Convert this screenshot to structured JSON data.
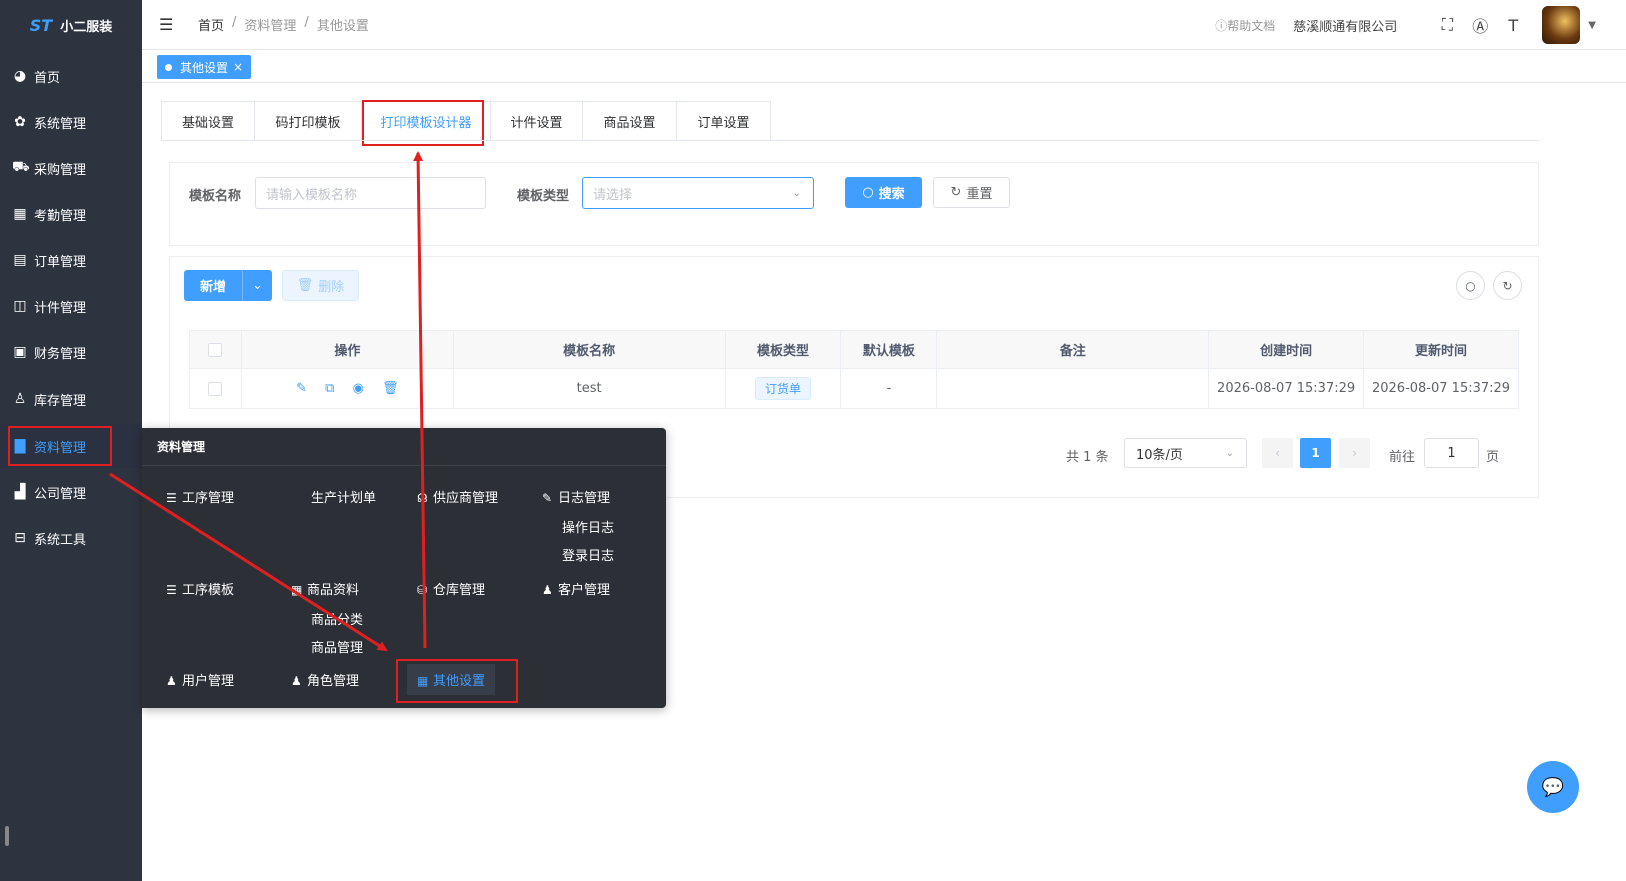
{
  "app": {
    "name": "小二服装",
    "logo_mark": "ST"
  },
  "sidebar": {
    "items": [
      {
        "label": "首页",
        "icon": "dashboard-icon"
      },
      {
        "label": "系统管理",
        "icon": "gear-icon"
      },
      {
        "label": "采购管理",
        "icon": "cart-icon"
      },
      {
        "label": "考勤管理",
        "icon": "grid-icon"
      },
      {
        "label": "订单管理",
        "icon": "order-icon"
      },
      {
        "label": "计件管理",
        "icon": "book-icon"
      },
      {
        "label": "财务管理",
        "icon": "chart-icon"
      },
      {
        "label": "库存管理",
        "icon": "user-icon"
      },
      {
        "label": "资料管理",
        "icon": "document-icon"
      },
      {
        "label": "公司管理",
        "icon": "bar-chart-icon"
      },
      {
        "label": "系统工具",
        "icon": "toolbox-icon"
      }
    ],
    "active_index": 8
  },
  "header": {
    "breadcrumb": [
      "首页",
      "资料管理",
      "其他设置"
    ],
    "separator": "/",
    "help": "帮助文档",
    "company": "慈溪顺通有限公司"
  },
  "tagsview": {
    "tags": [
      {
        "label": "其他设置",
        "close": "×"
      }
    ]
  },
  "tabs": {
    "items": [
      "基础设置",
      "码打印模板",
      "打印模板设计器",
      "计件设置",
      "商品设置",
      "订单设置"
    ],
    "active_index": 2
  },
  "search": {
    "name_label": "模板名称",
    "name_placeholder": "请输入模板名称",
    "type_label": "模板类型",
    "type_placeholder": "请选择",
    "search_button": "搜索",
    "reset_button": "重置"
  },
  "toolbar": {
    "add": "新增",
    "delete": "删除"
  },
  "table": {
    "columns": [
      "操作",
      "模板名称",
      "模板类型",
      "默认模板",
      "备注",
      "创建时间",
      "更新时间"
    ],
    "rows": [
      {
        "name": "test",
        "type": "订货单",
        "default": "-",
        "remark": "",
        "created": "2026-08-07 15:37:29",
        "updated": "2026-08-07 15:37:29"
      }
    ]
  },
  "pagination": {
    "total": "共 1 条",
    "page_size": "10条/页",
    "current": "1",
    "goto_label": "前往",
    "goto_value": "1",
    "page_suffix": "页"
  },
  "flyout": {
    "title": "资料管理",
    "items": {
      "process_mgmt": "工序管理",
      "production_plan": "生产计划单",
      "supplier_mgmt": "供应商管理",
      "log_mgmt": "日志管理",
      "op_log": "操作日志",
      "login_log": "登录日志",
      "process_template": "工序模板",
      "goods_info": "商品资料",
      "warehouse_mgmt": "仓库管理",
      "customer_mgmt": "客户管理",
      "goods_category": "商品分类",
      "goods_mgmt": "商品管理",
      "user_mgmt": "用户管理",
      "role_mgmt": "角色管理",
      "other_settings": "其他设置"
    }
  },
  "colors": {
    "accent": "#409eff",
    "sidebar_bg": "#2e3340",
    "annotation": "#e02020",
    "flyout_bg": "#2c2f36"
  }
}
